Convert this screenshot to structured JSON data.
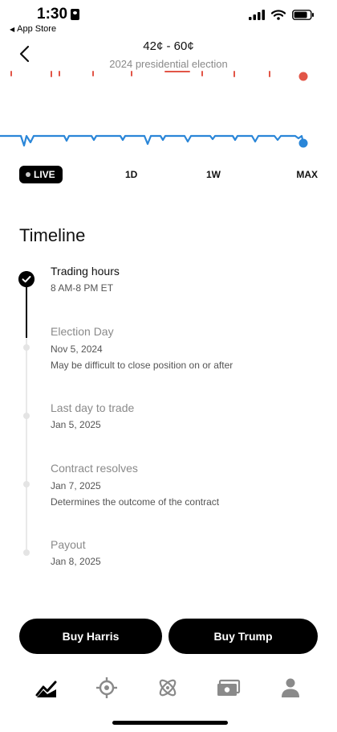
{
  "status_bar": {
    "time": "1:30",
    "back_app_label": "App Store"
  },
  "header": {
    "title": "42¢ - 60¢",
    "subtitle": "2024 presidential election"
  },
  "chart_colors": {
    "blue_line": "#2a86d8",
    "red_marks": "#e25547"
  },
  "ranges": {
    "live": "LIVE",
    "day": "1D",
    "week": "1W",
    "max": "MAX",
    "selected": "LIVE"
  },
  "timeline": {
    "title": "Timeline",
    "steps": [
      {
        "title": "Trading hours",
        "lines": [
          "8 AM-8 PM ET"
        ],
        "completed": true
      },
      {
        "title": "Election Day",
        "lines": [
          "Nov 5, 2024",
          "May be difficult to close position on or after"
        ],
        "completed": false
      },
      {
        "title": "Last day to trade",
        "lines": [
          "Jan 5, 2025"
        ],
        "completed": false
      },
      {
        "title": "Contract resolves",
        "lines": [
          "Jan 7, 2025",
          "Determines the outcome of the contract"
        ],
        "completed": false
      },
      {
        "title": "Payout",
        "lines": [
          "Jan 8, 2025"
        ],
        "completed": false
      }
    ]
  },
  "actions": {
    "buy_harris": "Buy Harris",
    "buy_trump": "Buy Trump"
  },
  "tab_bar": {
    "items": [
      "chart-icon",
      "target-icon",
      "atom-icon",
      "cash-icon",
      "person-icon"
    ],
    "active": "chart-icon"
  }
}
